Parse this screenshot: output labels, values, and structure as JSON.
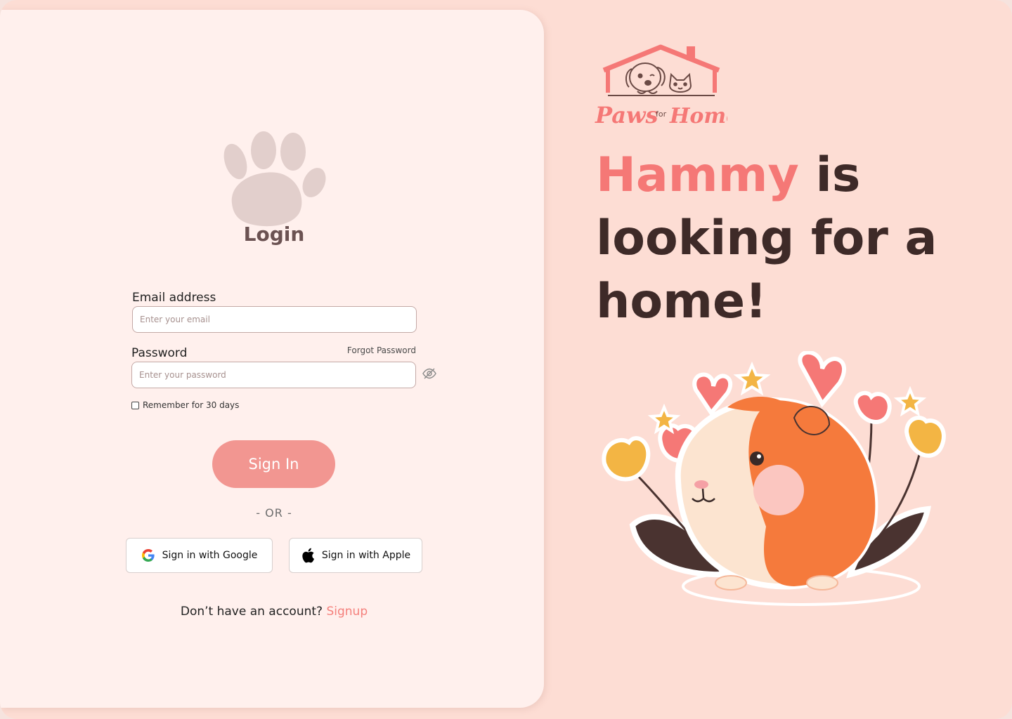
{
  "login": {
    "title": "Login",
    "email_label": "Email address",
    "email_placeholder": "Enter your email",
    "email_value": "",
    "password_label": "Password",
    "password_placeholder": "Enter your password",
    "password_value": "",
    "forgot_label": "Forgot Password",
    "remember_label": "Remember for 30 days",
    "remember_checked": false,
    "signin_label": "Sign In",
    "or_label": "-  OR -",
    "google_label": "Sign in with Google",
    "apple_label": "Sign in with Apple",
    "no_account_text": "Don’t have an account? ",
    "signup_label": "Signup"
  },
  "brand": {
    "logo_word_left": "Paws",
    "logo_word_mid": "for",
    "logo_word_right": "Home"
  },
  "hero": {
    "pet_name": "Hammy",
    "headline_rest": " is looking for a home!"
  },
  "colors": {
    "page_bg": "#fdddd4",
    "card_bg": "#fff0ed",
    "accent": "#f57876",
    "button": "#f29691",
    "headline": "#3e2a28",
    "paw": "#e2cfcc"
  },
  "icons": {
    "paw": "paw-icon",
    "eye": "eye-off-icon",
    "google": "google-icon",
    "apple": "apple-icon",
    "logo": "house-dog-cat-logo"
  }
}
